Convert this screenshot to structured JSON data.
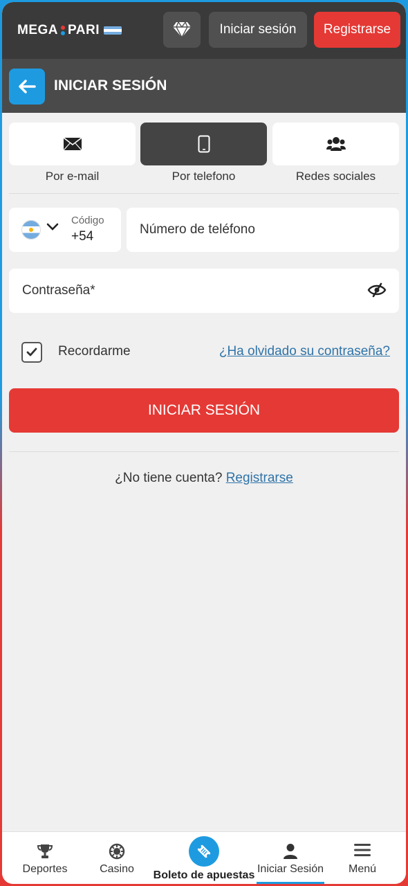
{
  "header": {
    "logo_text_left": "MEGA",
    "logo_text_right": "PARI",
    "login_label": "Iniciar sesión",
    "register_label": "Registrarse"
  },
  "subheader": {
    "title": "INICIAR SESIÓN"
  },
  "tabs": [
    {
      "label": "Por e-mail",
      "icon": "envelope-icon",
      "active": false
    },
    {
      "label": "Por telefono",
      "icon": "mobile-phone-icon",
      "active": true
    },
    {
      "label": "Redes sociales",
      "icon": "users-group-icon",
      "active": false
    }
  ],
  "form": {
    "code_label": "Código",
    "code_value": "+54",
    "phone_placeholder": "Número de teléfono",
    "password_placeholder": "Contraseña*",
    "remember_label": "Recordarme",
    "remember_checked": true,
    "forgot_label": "¿Ha olvidado su contraseña?",
    "submit_label": "INICIAR SESIÓN",
    "no_account_text": "¿No tiene cuenta?",
    "register_link": "Registrarse"
  },
  "bottom_nav": [
    {
      "label": "Deportes",
      "icon": "trophy-icon"
    },
    {
      "label": "Casino",
      "icon": "casino-chip-icon"
    },
    {
      "label": "Boleto de apuestas",
      "icon": "ticket-icon"
    },
    {
      "label": "Iniciar Sesión",
      "icon": "user-icon",
      "active": true
    },
    {
      "label": "Menú",
      "icon": "hamburger-menu-icon"
    }
  ],
  "colors": {
    "accent_blue": "#1e9be0",
    "accent_red": "#e53935",
    "header_dark": "#3a3a3a"
  }
}
